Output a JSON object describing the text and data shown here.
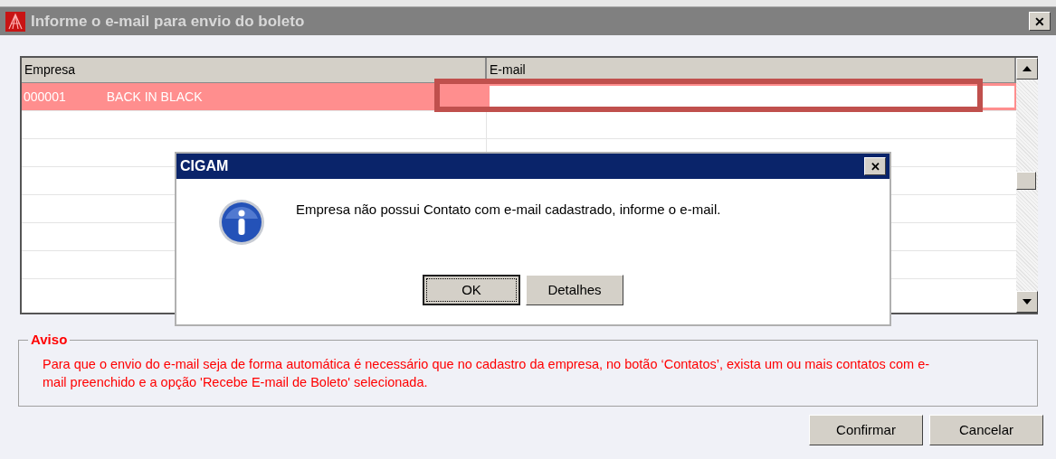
{
  "window": {
    "title": "Informe o e-mail para envio do boleto",
    "close": "✕"
  },
  "table": {
    "columns": [
      "Empresa",
      "E-mail"
    ],
    "rows": [
      {
        "code": "000001",
        "name": "BACK IN BLACK",
        "email": "",
        "selected": true,
        "email_highlighted": true
      }
    ]
  },
  "dialog": {
    "title": "CIGAM",
    "close": "✕",
    "message": "Empresa não possui Contato com e-mail cadastrado, informe o e-mail.",
    "buttons": [
      {
        "label": "OK",
        "focused": true
      },
      {
        "label": "Detalhes",
        "focused": false
      }
    ]
  },
  "notice": {
    "title": "Aviso",
    "text": "Para que o envio do e-mail seja de forma automática é necessário que no cadastro da empresa, no botão ‘Contatos’, exista um ou mais contatos com e-mail preenchido e a opção 'Recebe E-mail de Boleto' selecionada."
  },
  "buttons": [
    "Confirmar",
    "Cancelar"
  ]
}
